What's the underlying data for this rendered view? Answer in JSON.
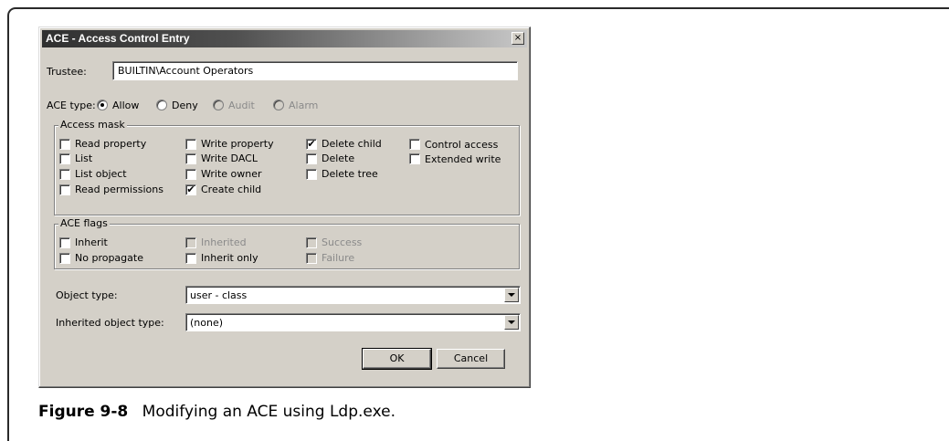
{
  "dialog": {
    "title": "ACE - Access Control Entry",
    "close_glyph": "×",
    "trustee_label": "Trustee:",
    "trustee_value": "BUILTIN\\Account Operators",
    "ace_type_label": "ACE type:",
    "ace_types": [
      "Allow",
      "Deny",
      "Audit",
      "Alarm"
    ],
    "selected_ace_type": "Allow",
    "access_mask": {
      "title": "Access mask",
      "items": [
        {
          "label": "Read property",
          "checked": false
        },
        {
          "label": "List",
          "checked": false
        },
        {
          "label": "List object",
          "checked": false
        },
        {
          "label": "Read permissions",
          "checked": false
        },
        {
          "label": "Write property",
          "checked": false
        },
        {
          "label": "Write DACL",
          "checked": false
        },
        {
          "label": "Write owner",
          "checked": false
        },
        {
          "label": "Create child",
          "checked": true
        },
        {
          "label": "Delete child",
          "checked": true
        },
        {
          "label": "Delete",
          "checked": false
        },
        {
          "label": "Delete tree",
          "checked": false
        },
        {
          "label": "Control access",
          "checked": false
        },
        {
          "label": "Extended write",
          "checked": false
        }
      ]
    },
    "ace_flags": {
      "title": "ACE flags",
      "items": [
        {
          "label": "Inherit",
          "checked": false,
          "enabled": true
        },
        {
          "label": "No propagate",
          "checked": false,
          "enabled": true
        },
        {
          "label": "Inherited",
          "checked": false,
          "enabled": false
        },
        {
          "label": "Inherit only",
          "checked": false,
          "enabled": true
        },
        {
          "label": "Success",
          "checked": false,
          "enabled": false
        },
        {
          "label": "Failure",
          "checked": false,
          "enabled": false
        }
      ]
    },
    "object_type_label": "Object type:",
    "object_type_value": "user - class",
    "inherited_object_type_label": "Inherited object type:",
    "inherited_object_type_value": "(none)",
    "ok_label": "OK",
    "cancel_label": "Cancel"
  },
  "caption": {
    "number": "Figure 9-8",
    "text": "Modifying an ACE using Ldp.exe."
  }
}
